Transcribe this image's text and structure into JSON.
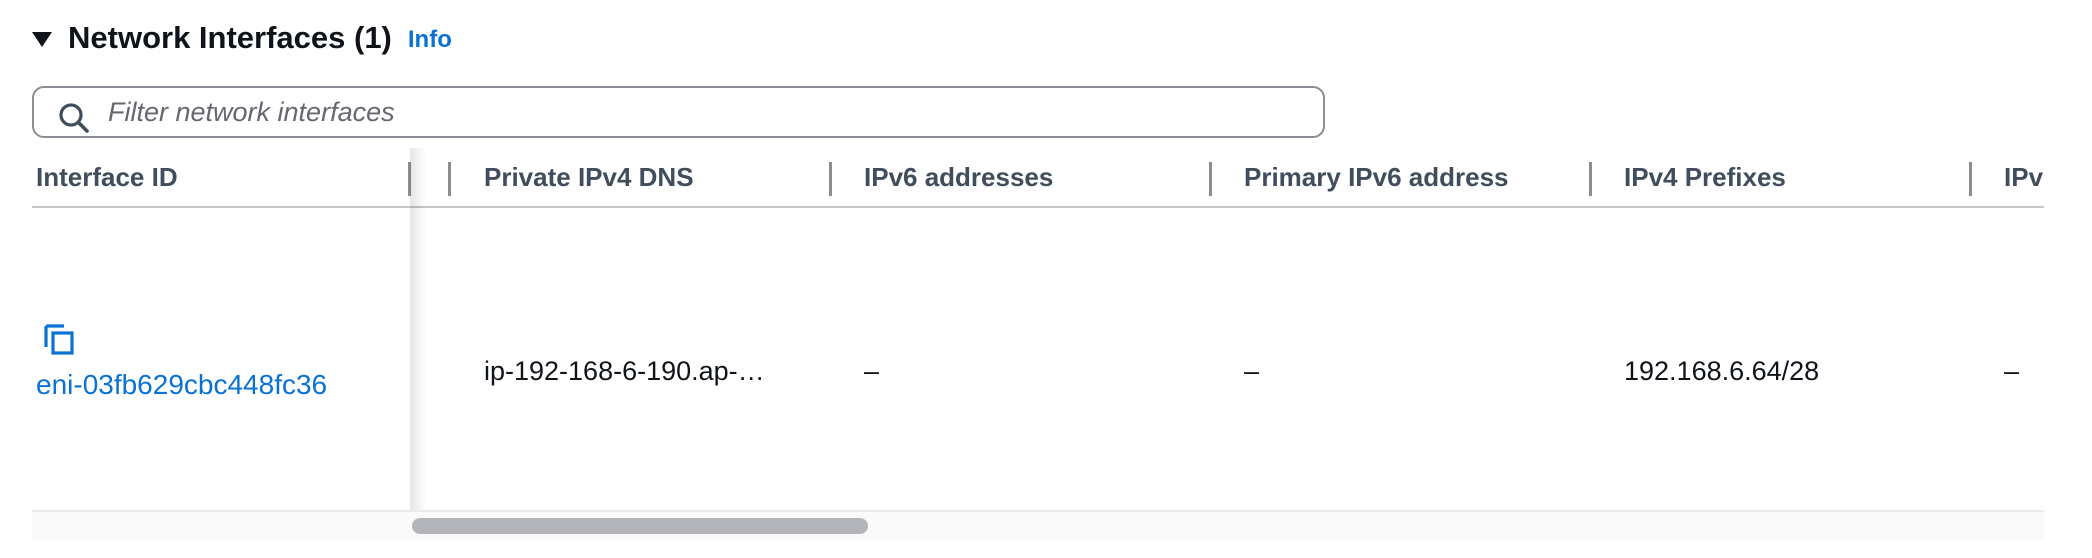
{
  "section": {
    "title": "Network Interfaces (1)",
    "info_label": "Info"
  },
  "filter": {
    "placeholder": "Filter network interfaces",
    "value": ""
  },
  "table": {
    "columns": [
      "Interface ID",
      "Private IPv4 DNS",
      "IPv6 addresses",
      "Primary IPv6 address",
      "IPv4 Prefixes",
      "IPv"
    ],
    "rows": [
      {
        "interface_id": "eni-03fb629cbc448fc36",
        "private_ipv4_dns": "ip-192-168-6-190.ap-…",
        "ipv6_addresses": "–",
        "primary_ipv6_address": "–",
        "ipv4_prefixes": "192.168.6.64/28",
        "ipv": "–"
      }
    ]
  },
  "icons": {
    "caret": "caret-down-icon",
    "search": "search-icon",
    "copy": "copy-icon"
  },
  "colors": {
    "link": "#0972d3",
    "text": "#0f141a",
    "header_text": "#414d5c",
    "border": "#8c8c94"
  }
}
